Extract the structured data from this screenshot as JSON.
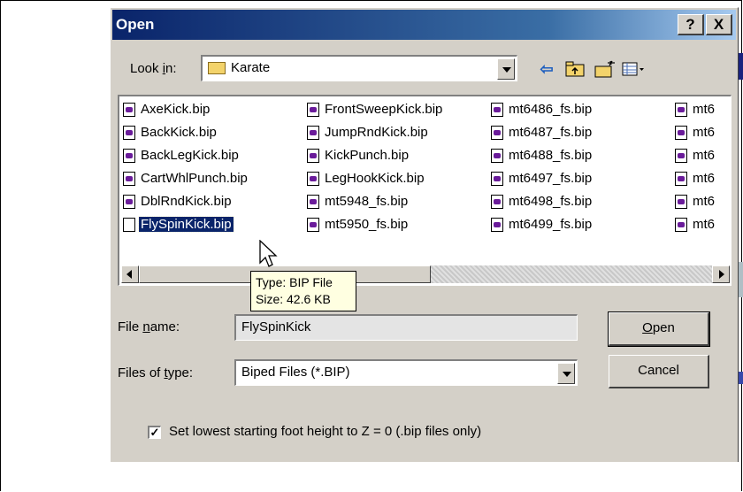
{
  "dialog": {
    "title": "Open",
    "help_label": "?",
    "close_label": "X"
  },
  "look_in": {
    "label": "Look in:",
    "value": "Karate"
  },
  "toolbar": {
    "back_icon": "back-arrow-icon",
    "up_icon": "up-folder-icon",
    "new_folder_icon": "new-folder-icon",
    "view_icon": "view-menu-icon"
  },
  "files": {
    "col1": [
      "AxeKick.bip",
      "BackKick.bip",
      "BackLegKick.bip",
      "CartWhlPunch.bip",
      "DblRndKick.bip",
      "FlySpinKick.bip"
    ],
    "col2": [
      "FrontSweepKick.bip",
      "JumpRndKick.bip",
      "KickPunch.bip",
      "LegHookKick.bip",
      "mt5948_fs.bip",
      "mt5950_fs.bip"
    ],
    "col3": [
      "mt6486_fs.bip",
      "mt6487_fs.bip",
      "mt6488_fs.bip",
      "mt6497_fs.bip",
      "mt6498_fs.bip",
      "mt6499_fs.bip"
    ],
    "col4": [
      "mt6",
      "mt6",
      "mt6",
      "mt6",
      "mt6",
      "mt6"
    ],
    "selected": "FlySpinKick.bip"
  },
  "tooltip": {
    "line1": "Type: BIP File",
    "line2": "Size: 42.6 KB"
  },
  "file_name": {
    "label": "File name:",
    "value": "FlySpinKick"
  },
  "file_type": {
    "label": "Files of type:",
    "value": "Biped Files (*.BIP)"
  },
  "buttons": {
    "open": "Open",
    "cancel": "Cancel"
  },
  "option": {
    "checked": true,
    "label": "Set lowest starting foot height to Z = 0 (.bip files only)"
  },
  "colors": {
    "titlebar": "#0a246a",
    "selection": "#0a246a",
    "face": "#d4d0c8",
    "tooltip": "#ffffe1"
  }
}
